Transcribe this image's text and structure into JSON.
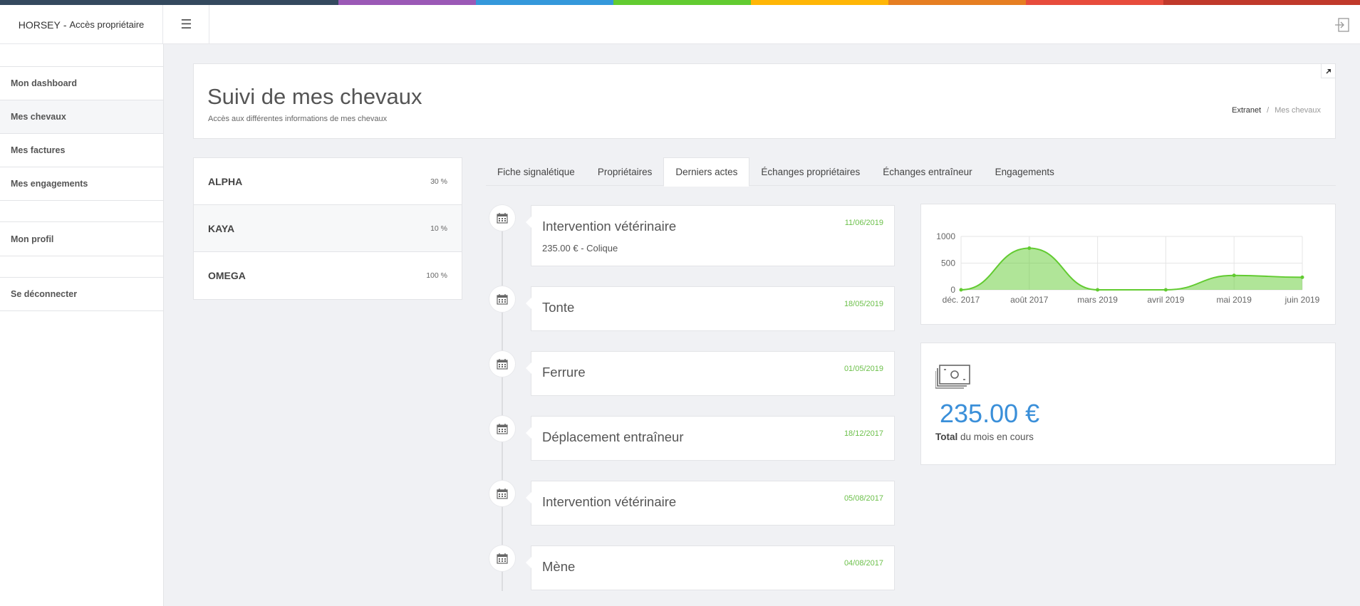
{
  "app": {
    "brand": "HORSEY",
    "brand_separator": "-",
    "brand_subtitle": "Accès propriétaire"
  },
  "colors": {
    "stripe": [
      "#34495e",
      "#9b59b6",
      "#3498db",
      "#62cb31",
      "#ffb606",
      "#e67e22",
      "#e74c3c",
      "#c0392b"
    ],
    "accent_green": "#6cc04a",
    "accent_blue": "#3a8fd9"
  },
  "sidebar": {
    "items": [
      {
        "label": "Mon dashboard",
        "icon": "none"
      },
      {
        "label": "Mes chevaux",
        "active": true
      },
      {
        "label": "Mes factures"
      },
      {
        "label": "Mes engagements"
      }
    ],
    "secondary": [
      {
        "label": "Mon profil"
      },
      {
        "label": "Se déconnecter"
      }
    ]
  },
  "header": {
    "title": "Suivi de mes chevaux",
    "subtitle": "Accès aux différentes informations de mes chevaux",
    "breadcrumb": [
      "Extranet",
      "Mes chevaux"
    ],
    "breadcrumb_separator": "/"
  },
  "horses": [
    {
      "name": "ALPHA",
      "percent": "30 %"
    },
    {
      "name": "KAYA",
      "percent": "10 %",
      "active": true
    },
    {
      "name": "OMEGA",
      "percent": "100 %"
    }
  ],
  "tabs": [
    {
      "label": "Fiche signalétique"
    },
    {
      "label": "Propriétaires"
    },
    {
      "label": "Derniers actes",
      "active": true
    },
    {
      "label": "Échanges propriétaires"
    },
    {
      "label": "Échanges entraîneur"
    },
    {
      "label": "Engagements"
    }
  ],
  "timeline": [
    {
      "title": "Intervention vétérinaire",
      "date": "11/06/2019",
      "detail": "235.00 € - Colique",
      "icon": "calendar-icon"
    },
    {
      "title": "Tonte",
      "date": "18/05/2019",
      "icon": "calendar-icon"
    },
    {
      "title": "Ferrure",
      "date": "01/05/2019",
      "icon": "calendar-icon"
    },
    {
      "title": "Déplacement entraîneur",
      "date": "18/12/2017",
      "icon": "calendar-icon"
    },
    {
      "title": "Intervention vétérinaire",
      "date": "05/08/2017",
      "icon": "calendar-icon"
    },
    {
      "title": "Mène",
      "date": "04/08/2017",
      "icon": "calendar-icon"
    }
  ],
  "chart_data": {
    "type": "area",
    "categories": [
      "déc. 2017",
      "août 2017",
      "mars 2019",
      "avril 2019",
      "mai 2019",
      "juin 2019"
    ],
    "series": [
      {
        "values": [
          0,
          780,
          0,
          0,
          270,
          235
        ],
        "color": "#62cb31"
      }
    ],
    "yticks": [
      0,
      500,
      1000
    ],
    "ylim": [
      0,
      1000
    ],
    "grid": true
  },
  "total": {
    "amount": "235.00 €",
    "label_bold": "Total",
    "label_rest": "du mois en cours",
    "icon": "money-icon"
  }
}
